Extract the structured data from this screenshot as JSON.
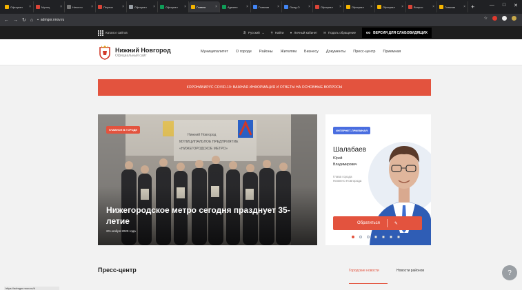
{
  "browser": {
    "tabs": [
      {
        "label": "Официал",
        "color": "#f4b400"
      },
      {
        "label": "Муниц",
        "color": "#db4437"
      },
      {
        "label": "Ника по",
        "color": "#777"
      },
      {
        "label": "Перечи",
        "color": "#db4437"
      },
      {
        "label": "Официал",
        "color": "#9aa0a6"
      },
      {
        "label": "Официал",
        "color": "#0f9d58"
      },
      {
        "label": "Главна",
        "color": "#f4b400",
        "active": true
      },
      {
        "label": "Админи",
        "color": "#0f9d58"
      },
      {
        "label": "Главная",
        "color": "#4285f4"
      },
      {
        "label": "Ожид О",
        "color": "#4285f4"
      },
      {
        "label": "Официал",
        "color": "#db4437"
      },
      {
        "label": "Официал",
        "color": "#f4b400"
      },
      {
        "label": "Официал",
        "color": "#f4b400"
      },
      {
        "label": "Вопрос",
        "color": "#db4437"
      },
      {
        "label": "Главная",
        "color": "#f4b400"
      }
    ],
    "new_tab": "+",
    "window_controls": [
      "—",
      "□",
      "✕"
    ],
    "url": "admgor.nnov.ru"
  },
  "util": {
    "catalog": "Каталог сайтов",
    "language": "Русский",
    "search": "Найти",
    "cabinet": "Личный кабинет",
    "appeal": "Подать обращение",
    "vision": "ВЕРСИЯ ДЛЯ СЛАБОВИДЯЩИХ"
  },
  "header": {
    "title": "Нижний Новгород",
    "subtitle": "Официальный сайт",
    "nav": [
      "Муниципалитет",
      "О городе",
      "Районы",
      "Жителям",
      "Бизнесу",
      "Документы",
      "Пресс-центр",
      "Приемная"
    ]
  },
  "alert": "КОРОНАВИРУС COVID-19: ВАЖНАЯ ИНФОРМАЦИЯ И ОТВЕТЫ НА ОСНОВНЫЕ ВОПРОСЫ",
  "news": {
    "badge": "ГЛАВНОЕ В ГОРОДЕ",
    "title": "Нижегородское метро сегодня празднует 35-летие",
    "date": "20 ноября 2020 года",
    "sign_text": "Нижний Новгород\nМУНИЦИПАЛЬНОЕ ПРЕДПРИЯТИЕ\n«НИЖЕГОРОДСКОЕ МЕТРО»"
  },
  "person": {
    "badge": "ИНТЕРНЕТ-ПРИЕМНАЯ",
    "last_name": "Шалабаев",
    "first_name": "Юрий",
    "patronymic": "Владимирович",
    "role_line1": "Глава города",
    "role_line2": "Нижнего Новгорода",
    "button": "Обратиться",
    "dots_total": 7,
    "dots_active": 0
  },
  "press": {
    "title": "Пресс-центр",
    "tab_active": "Городские новости",
    "tab_other": "Новости районов"
  },
  "status_url": "https://admgor.nnov.ru/#"
}
